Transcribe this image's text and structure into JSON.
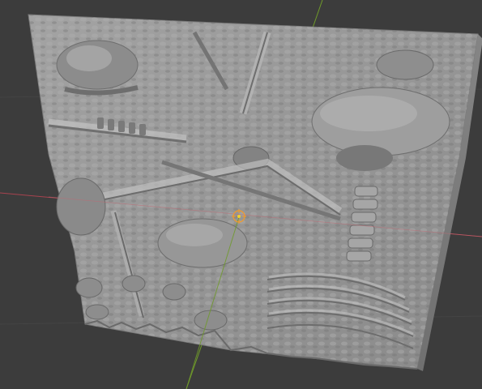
{
  "viewport": {
    "background_color": "#3c3c3c",
    "grid_line_color": "#454545",
    "x_axis_color": "#a8434f",
    "y_axis_color": "#6f9a2a",
    "origin_color": "#f29a2a"
  },
  "object": {
    "name": "",
    "material_color": "#9a9a9a",
    "shadow_color": "#6e6e6e",
    "highlight_color": "#c9c9c9",
    "edge_color": "#7a7a7a"
  },
  "icons": {
    "origin_marker": "origin-marker-icon"
  }
}
